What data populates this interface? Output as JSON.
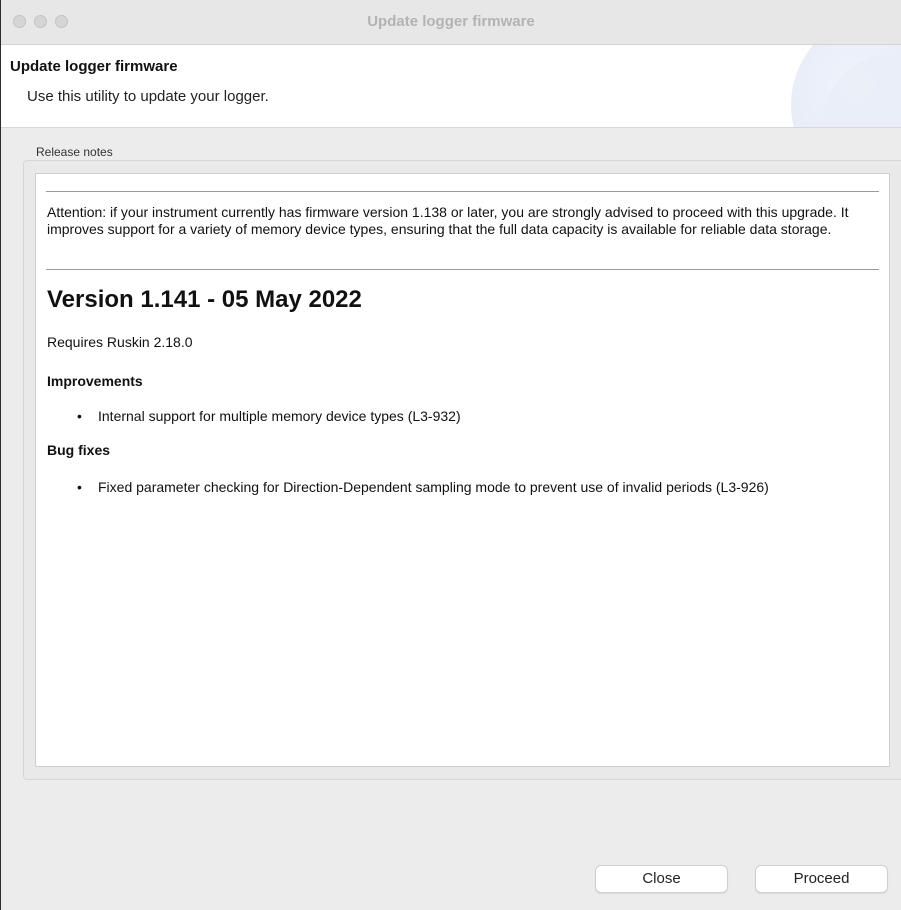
{
  "window": {
    "title": "Update logger firmware"
  },
  "banner": {
    "title": "Update logger firmware",
    "description": "Use this utility to update your logger."
  },
  "release_notes": {
    "group_label": "Release notes",
    "attention": "Attention: if your instrument currently has firmware version 1.138 or later, you are strongly advised to proceed with this upgrade. It improves support for a variety of memory device types, ensuring that the full data capacity is available for reliable data storage.",
    "version_heading": "Version 1.141 - 05 May 2022",
    "requires": "Requires Ruskin 2.18.0",
    "improvements": {
      "heading": "Improvements",
      "items": [
        "Internal support for multiple memory device types (L3-932)"
      ]
    },
    "bug_fixes": {
      "heading": "Bug fixes",
      "items": [
        "Fixed parameter checking for Direction-Dependent sampling mode to prevent use of invalid periods (L3-926)"
      ]
    }
  },
  "buttons": {
    "close": "Close",
    "proceed": "Proceed"
  }
}
